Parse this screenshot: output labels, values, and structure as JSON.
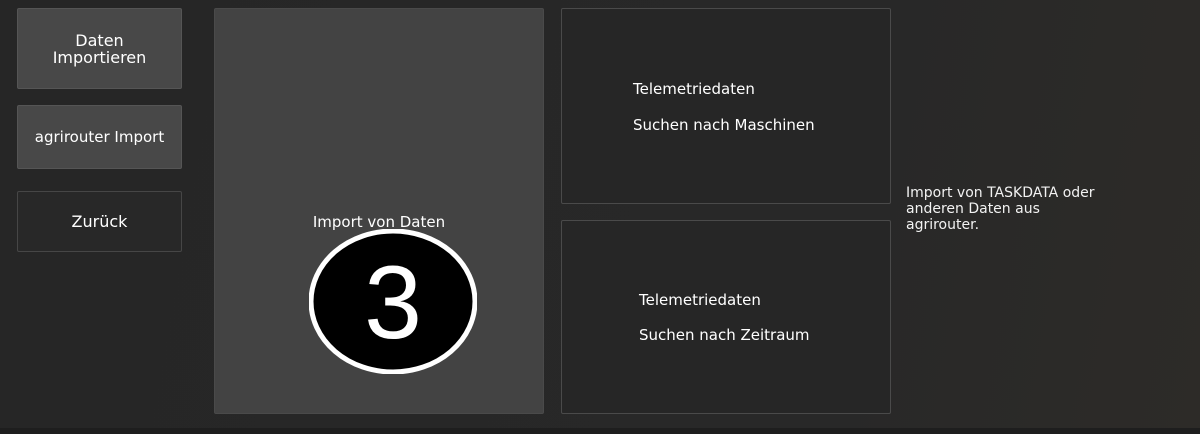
{
  "sidebar": {
    "import_label": "Daten Importieren",
    "agrirouter_label": "agrirouter Import",
    "back_label": "Zurück"
  },
  "tiles": {
    "import_data": {
      "label": "Import von Daten"
    },
    "telemetry_machines": {
      "title": "Telemetriedaten",
      "subtitle": "Suchen nach Maschinen"
    },
    "telemetry_period": {
      "title": "Telemetriedaten",
      "subtitle": "Suchen nach Zeitraum"
    }
  },
  "info": {
    "text": "Import von TASKDATA oder anderen Daten aus agrirouter."
  },
  "step_marker": {
    "number": "3"
  },
  "colors": {
    "background": "#272727",
    "active_tile": "#434343",
    "button_grey": "#484848",
    "text": "#ffffff"
  }
}
